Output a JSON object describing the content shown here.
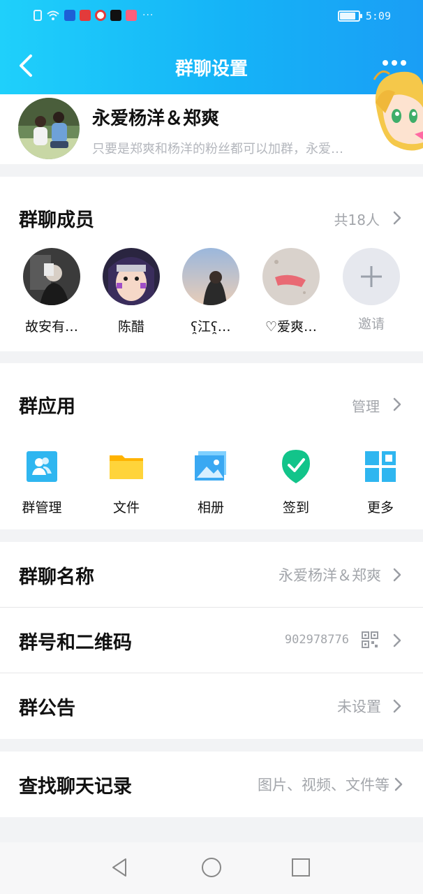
{
  "status_bar": {
    "time": "5:09",
    "more": "···"
  },
  "header": {
    "title": "群聊设置"
  },
  "group": {
    "name": "永爱杨洋＆郑爽",
    "description": "只要是郑爽和杨洋的粉丝都可以加群，永爱…"
  },
  "members": {
    "title": "群聊成员",
    "count_label": "共18人",
    "items": [
      {
        "name": "故安有…"
      },
      {
        "name": "陈醋"
      },
      {
        "name": "ʕ̯江ʕ̯…"
      },
      {
        "name": "♡爱爽…"
      },
      {
        "name": "邀请"
      }
    ]
  },
  "apps": {
    "title": "群应用",
    "manage_label": "管理",
    "items": [
      {
        "label": "群管理",
        "icon": "group-manage-icon"
      },
      {
        "label": "文件",
        "icon": "folder-icon"
      },
      {
        "label": "相册",
        "icon": "photo-album-icon"
      },
      {
        "label": "签到",
        "icon": "check-in-icon"
      },
      {
        "label": "更多",
        "icon": "more-apps-icon"
      }
    ]
  },
  "settings": {
    "group_name": {
      "label": "群聊名称",
      "value": "永爱杨洋＆郑爽"
    },
    "group_id": {
      "label": "群号和二维码",
      "value": "902978776"
    },
    "announcement": {
      "label": "群公告",
      "value": "未设置"
    },
    "search_history": {
      "label": "查找聊天记录",
      "value": "图片、视频、文件等"
    }
  },
  "colors": {
    "header_start": "#1fd0fb",
    "header_end": "#1a9ef5",
    "check_in_green": "#12c48a",
    "app_blue": "#2fb6f0",
    "folder_yellow": "#ffc91a"
  }
}
